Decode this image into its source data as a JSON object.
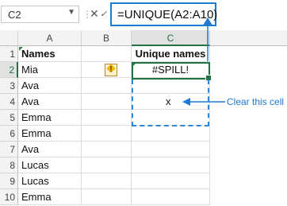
{
  "formula_bar": {
    "name_box": "C2",
    "formula": "=UNIQUE(A2:A10)"
  },
  "columns": [
    "A",
    "B",
    "C"
  ],
  "rows": [
    "1",
    "2",
    "3",
    "4",
    "5",
    "6",
    "7",
    "8",
    "9",
    "10"
  ],
  "cells": {
    "A1": "Names",
    "C1": "Unique names",
    "A2": "Mia",
    "A3": "Ava",
    "A4": "Ava",
    "A5": "Emma",
    "A6": "Emma",
    "A7": "Ava",
    "A8": "Lucas",
    "A9": "Lucas",
    "A10": "Emma",
    "C2": "#SPILL!",
    "C4": "x"
  },
  "warning_icon": "exclamation-diamond-icon",
  "annotation": "Clear this cell",
  "colors": {
    "accent_blue": "#1f7ad1",
    "excel_green": "#217346"
  }
}
